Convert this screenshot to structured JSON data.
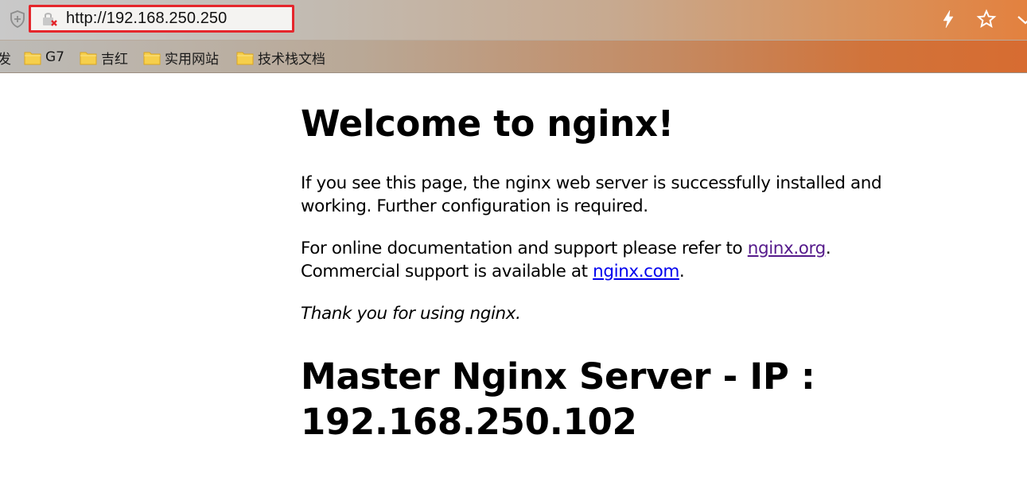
{
  "browser": {
    "url": "http://192.168.250.250",
    "colors": {
      "address_border": "#e5262c",
      "link": "#0000ee",
      "visited_link": "#551a8b"
    },
    "icons": [
      "shield-icon",
      "insecure-lock-icon",
      "lightning-icon",
      "star-icon",
      "chevron-down-icon",
      "folder-icon"
    ]
  },
  "bookmarks": {
    "items": [
      {
        "label": "发"
      },
      {
        "label": "G7"
      },
      {
        "label": "吉红"
      },
      {
        "label": "实用网站"
      },
      {
        "label": "技术栈文档"
      }
    ]
  },
  "page": {
    "title": "Welcome to nginx!",
    "para1": "If you see this page, the nginx web server is successfully installed and working. Further configuration is required.",
    "para2_prefix": "For online documentation and support please refer to ",
    "org_link": "nginx.org",
    "para2_middle": ".",
    "para2_line2_prefix": "Commercial support is available at ",
    "com_link": "nginx.com",
    "para2_suffix": ".",
    "thanks": "Thank you for using nginx.",
    "master_title": "Master Nginx Server - IP : 192.168.250.102"
  }
}
